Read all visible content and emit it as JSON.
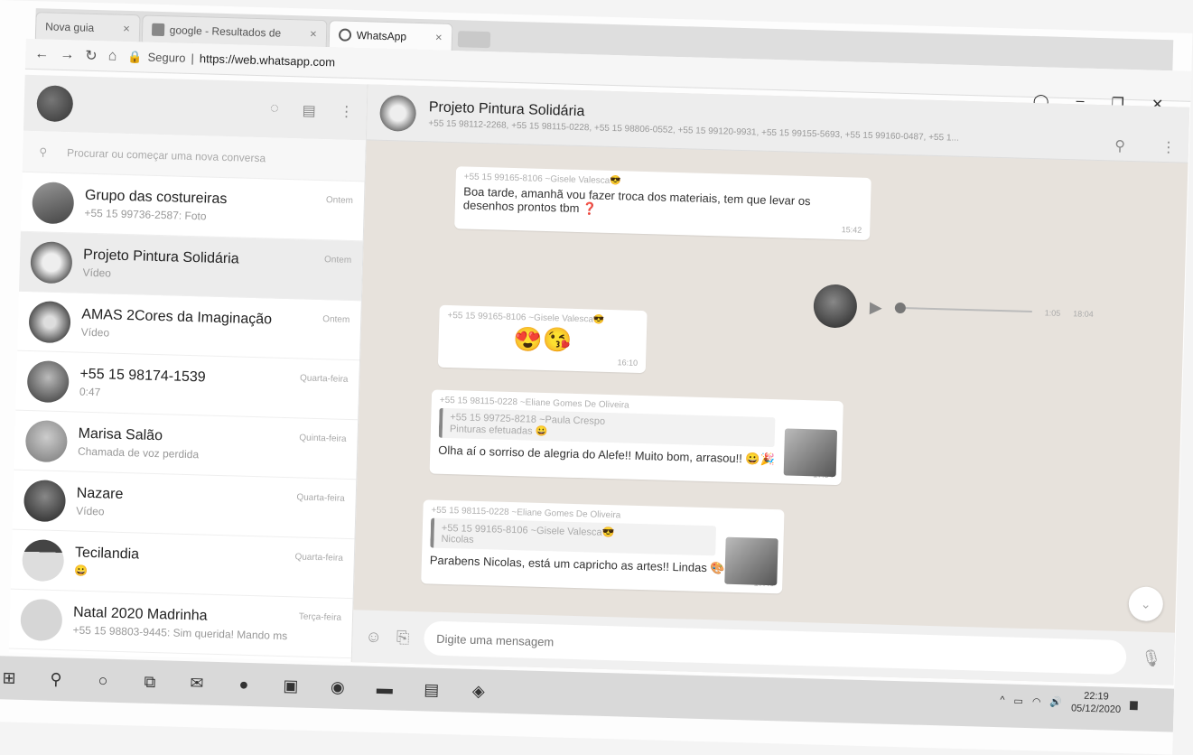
{
  "browser": {
    "tabs": [
      {
        "label": "Nova guia",
        "close": "×"
      },
      {
        "label": "google - Resultados de",
        "close": "×"
      },
      {
        "label": "WhatsApp",
        "close": "×"
      }
    ],
    "secure_label": "Seguro",
    "url": "https://web.whatsapp.com"
  },
  "sidebar": {
    "search_placeholder": "Procurar ou começar uma nova conversa",
    "conversations": [
      {
        "name": "Grupo das costureiras",
        "preview": "+55 15 99736-2587: Foto",
        "time": "Ontem"
      },
      {
        "name": "Projeto Pintura Solidária",
        "preview": "Vídeo",
        "time": "Ontem"
      },
      {
        "name": "AMAS 2Cores da Imaginação",
        "preview": "Vídeo",
        "time": "Ontem"
      },
      {
        "name": "+55 15 98174-1539",
        "preview": "0:47",
        "time": "Quarta-feira"
      },
      {
        "name": "Marisa Salão",
        "preview": "Chamada de voz perdida",
        "time": "Quinta-feira"
      },
      {
        "name": "Nazare",
        "preview": "Vídeo",
        "time": "Quarta-feira"
      },
      {
        "name": "Tecilandia",
        "preview": "😀",
        "time": "Quarta-feira"
      },
      {
        "name": "Natal 2020 Madrinha",
        "preview": "+55 15 98803-9445: Sim querida! Mando msg a...",
        "time": "Terça-feira"
      }
    ]
  },
  "chat": {
    "title": "Projeto Pintura Solidária",
    "members": "+55 15 98112-2268, +55 15 98115-0228, +55 15 98806-0552, +55 15 99120-9931, +55 15 99155-5693, +55 15 99160-0487, +55 1...",
    "messages": [
      {
        "sender": "+55 15 99165-8106 ~Gisele Valesca😎",
        "text": "Boa tarde, amanhã vou fazer troca dos materiais, tem que levar os desenhos prontos tbm ❓",
        "time": "15:42"
      },
      {
        "sender": "+55 15 99165-8106 ~Gisele Valesca😎",
        "text": "😍😘",
        "time": "16:10"
      },
      {
        "sender": "+55 15 98115-0228 ~Eliane Gomes De Oliveira",
        "quote_sender": "+55 15 99725-8218 ~Paula Crespo",
        "quote_text": "Pinturas efetuadas 😀",
        "text": "Olha aí o sorriso de alegria do Alefe!! Muito bom, arrasou!! 😀🎉",
        "time": "17:34"
      },
      {
        "sender": "+55 15 98115-0228 ~Eliane Gomes De Oliveira",
        "quote_sender": "+55 15 99165-8106 ~Gisele Valesca😎",
        "quote_text": "Nicolas",
        "text": "Parabens Nicolas, está um capricho as artes!! Lindas 🎨",
        "time": "17:40"
      }
    ],
    "audio": {
      "duration": "1:05",
      "time": "18:04"
    },
    "compose_placeholder": "Digite uma mensagem"
  },
  "taskbar": {
    "time": "22:19",
    "date": "05/12/2020"
  }
}
